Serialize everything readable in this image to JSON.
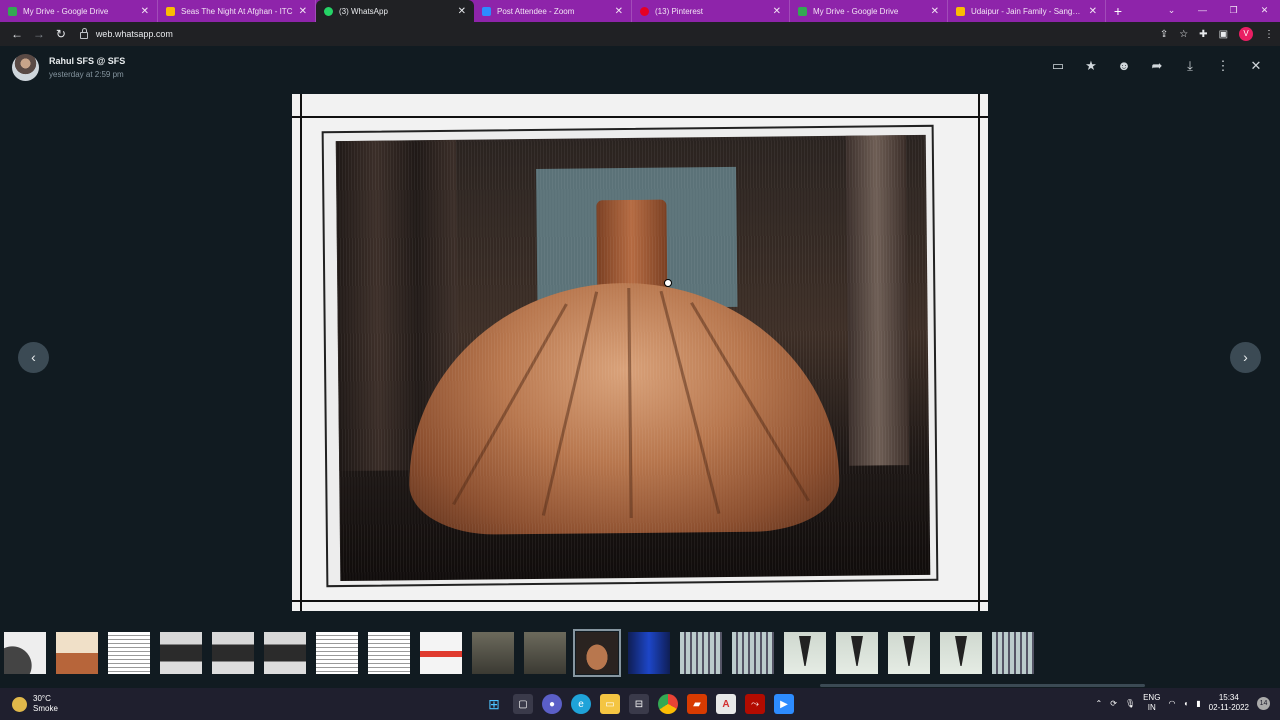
{
  "browser": {
    "tabs": [
      {
        "title": "My Drive - Google Drive",
        "color": "#34a853"
      },
      {
        "title": "Seas The Night At Afghan - ITC",
        "color": "#fbbc04"
      },
      {
        "title": "(3) WhatsApp",
        "color": "#25d366"
      },
      {
        "title": "Post Attendee - Zoom",
        "color": "#2d8cff"
      },
      {
        "title": "(13) Pinterest",
        "color": "#e60023"
      },
      {
        "title": "My Drive - Google Drive",
        "color": "#34a853"
      },
      {
        "title": "Udaipur - Jain Family - Sangeet",
        "color": "#fbbc04"
      }
    ],
    "new_tab": "+",
    "url": "web.whatsapp.com",
    "profile_initial": "V"
  },
  "viewer": {
    "sender": "Rahul SFS @ SFS",
    "timestamp": "yesterday at 2:59 pm"
  },
  "taskbar": {
    "temperature": "30°C",
    "condition": "Smoke",
    "lang_1": "ENG",
    "lang_2": "IN",
    "time": "15:34",
    "date": "02-11-2022",
    "notifications": "14"
  }
}
